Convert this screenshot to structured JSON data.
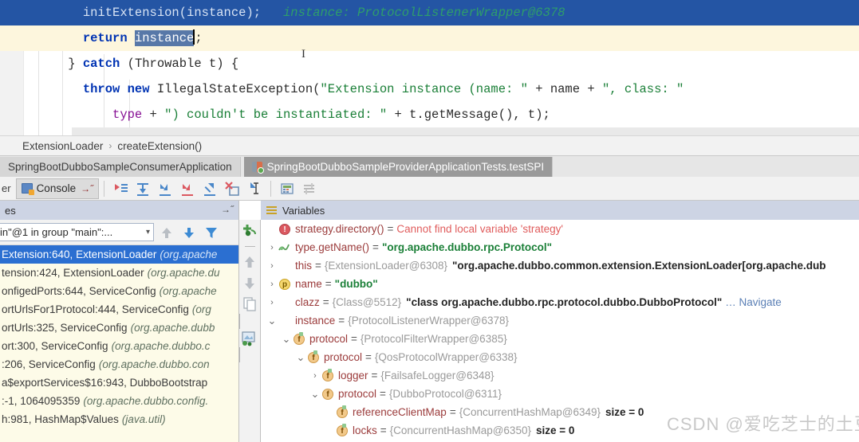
{
  "editor": {
    "lines": [
      {
        "indent": 6,
        "highlight": "selected",
        "tokens": [
          {
            "t": "initExtension",
            "c": "plain"
          },
          {
            "t": "(",
            "c": "plain"
          },
          {
            "t": "instance",
            "c": "plain"
          },
          {
            "t": ");",
            "c": "plain"
          }
        ],
        "hint": "instance: ProtocolListenerWrapper@6378"
      },
      {
        "indent": 6,
        "highlight": "current",
        "tokens": [
          {
            "t": "return ",
            "c": "kw"
          },
          {
            "t": "instance",
            "c": "selbox"
          },
          {
            "t": ";",
            "c": "plain"
          }
        ],
        "hint": ""
      },
      {
        "indent": 4,
        "highlight": "none",
        "tokens": [
          {
            "t": "} ",
            "c": "plain"
          },
          {
            "t": "catch ",
            "c": "kw"
          },
          {
            "t": "(Throwable t) {",
            "c": "plain"
          }
        ],
        "hint": ""
      },
      {
        "indent": 6,
        "highlight": "none",
        "tokens": [
          {
            "t": "throw new ",
            "c": "kw"
          },
          {
            "t": "IllegalStateException(",
            "c": "plain"
          },
          {
            "t": "\"Extension instance (name: \"",
            "c": "str"
          },
          {
            "t": " + ",
            "c": "plain"
          },
          {
            "t": "name",
            "c": "plain"
          },
          {
            "t": " + ",
            "c": "plain"
          },
          {
            "t": "\", class: \"",
            "c": "str"
          }
        ],
        "hint": ""
      },
      {
        "indent": 10,
        "highlight": "none",
        "tokens": [
          {
            "t": "type",
            "c": "fld"
          },
          {
            "t": " + ",
            "c": "plain"
          },
          {
            "t": "\") couldn't be instantiated: \"",
            "c": "str"
          },
          {
            "t": " + ",
            "c": "plain"
          },
          {
            "t": "t.getMessage(), t);",
            "c": "plain"
          }
        ],
        "hint": ""
      }
    ]
  },
  "breadcrumb": {
    "class_name": "ExtensionLoader",
    "separator": "›",
    "method_name": "createExtension()"
  },
  "run_tabs": [
    {
      "label": "SpringBootDubboSampleConsumerApplication",
      "active": false
    },
    {
      "label": "SpringBootDubboSampleProviderApplicationTests.testSPI",
      "active": true
    }
  ],
  "toolbar": {
    "left_label": "er",
    "console_label": "Console",
    "console_suffix": "→˝",
    "icons": [
      "show-execution-point-icon",
      "step-over-icon",
      "step-into-icon",
      "force-step-into-icon",
      "step-out-icon",
      "drop-frame-icon",
      "run-to-cursor-icon",
      "evaluate-expression-icon",
      "settings-lines-icon"
    ]
  },
  "frames_panel": {
    "title": "es",
    "collapse_glyph": "→˝",
    "thread_selector": "in\"@1 in group \"main\":...",
    "toolbar_icons": [
      "frames-up-icon",
      "frames-down-icon",
      "filter-icon"
    ],
    "frames": [
      {
        "text": "Extension:640, ExtensionLoader",
        "pkg": "(org.apache",
        "selected": true
      },
      {
        "text": "tension:424, ExtensionLoader",
        "pkg": "(org.apache.du",
        "selected": false
      },
      {
        "text": "onfigedPorts:644, ServiceConfig",
        "pkg": "(org.apache",
        "selected": false
      },
      {
        "text": "ortUrlsFor1Protocol:444, ServiceConfig",
        "pkg": "(org",
        "selected": false
      },
      {
        "text": "ortUrls:325, ServiceConfig",
        "pkg": "(org.apache.dubb",
        "selected": false
      },
      {
        "text": "ort:300, ServiceConfig",
        "pkg": "(org.apache.dubbo.c",
        "selected": false
      },
      {
        "text": ":206, ServiceConfig",
        "pkg": "(org.apache.dubbo.con",
        "selected": false
      },
      {
        "text": "a$exportServices$16:943, DubboBootstrap",
        "pkg": "",
        "selected": false
      },
      {
        "text": ":-1, 1064095359",
        "pkg": "(org.apache.dubbo.config.",
        "selected": false
      },
      {
        "text": "h:981, HashMap$Values",
        "pkg": "(java.util)",
        "selected": false
      }
    ]
  },
  "vstrip_icons": [
    "add-watch-icon",
    "remove-watch-icon",
    "move-up-icon",
    "move-down-icon",
    "copy-icon",
    "inspect-icon"
  ],
  "variables_panel": {
    "title": "Variables",
    "rows": [
      {
        "depth": 0,
        "twisty": "",
        "icon": "error-icon",
        "name": "strategy.directory()",
        "eq": "=",
        "value": "Cannot find local variable 'strategy'",
        "value_class": "verr",
        "extra": "",
        "extra_class": ""
      },
      {
        "depth": 0,
        "twisty": "›",
        "icon": "eval-icon",
        "name": "type.getName()",
        "eq": "=",
        "value": "\"org.apache.dubbo.rpc.Protocol\"",
        "value_class": "vval-str",
        "extra": "",
        "extra_class": ""
      },
      {
        "depth": 0,
        "twisty": "›",
        "icon": "list-icon",
        "name": "this",
        "eq": "=",
        "value": "{ExtensionLoader@6308}",
        "value_class": "vval-ref",
        "extra": "\"org.apache.dubbo.common.extension.ExtensionLoader[org.apache.dub",
        "extra_class": "vval-dark"
      },
      {
        "depth": 0,
        "twisty": "›",
        "icon": "param-icon",
        "name": "name",
        "eq": "=",
        "value": "\"dubbo\"",
        "value_class": "vval-str",
        "extra": "",
        "extra_class": ""
      },
      {
        "depth": 0,
        "twisty": "›",
        "icon": "list-icon",
        "name": "clazz",
        "eq": "=",
        "value": "{Class@5512}",
        "value_class": "vval-ref",
        "extra": "\"class org.apache.dubbo.rpc.protocol.dubbo.DubboProtocol\"",
        "extra_class": "vval-dark",
        "suffix": "… Navigate",
        "suffix_class": "vlink"
      },
      {
        "depth": 0,
        "twisty": "⌄",
        "icon": "list-icon",
        "name": "instance",
        "eq": "=",
        "value": "{ProtocolListenerWrapper@6378}",
        "value_class": "vval-ref",
        "extra": "",
        "extra_class": ""
      },
      {
        "depth": 1,
        "twisty": "⌄",
        "icon": "field-icon",
        "name": "protocol",
        "eq": "=",
        "value": "{ProtocolFilterWrapper@6385}",
        "value_class": "vval-ref",
        "extra": "",
        "extra_class": ""
      },
      {
        "depth": 2,
        "twisty": "⌄",
        "icon": "field-icon",
        "name": "protocol",
        "eq": "=",
        "value": "{QosProtocolWrapper@6338}",
        "value_class": "vval-ref",
        "extra": "",
        "extra_class": ""
      },
      {
        "depth": 3,
        "twisty": "›",
        "icon": "field-icon",
        "name": "logger",
        "eq": "=",
        "value": "{FailsafeLogger@6348}",
        "value_class": "vval-ref",
        "extra": "",
        "extra_class": ""
      },
      {
        "depth": 3,
        "twisty": "⌄",
        "icon": "field-plain-icon",
        "name": "protocol",
        "eq": "=",
        "value": "{DubboProtocol@6311}",
        "value_class": "vval-ref",
        "extra": "",
        "extra_class": ""
      },
      {
        "depth": 4,
        "twisty": "",
        "icon": "field-icon",
        "name": "referenceClientMap",
        "eq": "=",
        "value": "{ConcurrentHashMap@6349}",
        "value_class": "vval-ref",
        "extra": "size = 0",
        "extra_class": "vsize"
      },
      {
        "depth": 4,
        "twisty": "",
        "icon": "field-icon",
        "name": "locks",
        "eq": "=",
        "value": "{ConcurrentHashMap@6350}",
        "value_class": "vval-ref",
        "extra": "size = 0",
        "extra_class": "vsize"
      }
    ]
  },
  "watermark": {
    "text": "CSDN @爱吃芝士的土豆倪"
  },
  "colors": {
    "selection_blue": "#2455a4",
    "current_line": "#fdf6dd",
    "frames_bg": "#fdfbe8",
    "frame_selected": "#2b6fd1",
    "panel_header": "#cdd4e4",
    "error_red": "#e05c5c",
    "string_green": "#1a7f37",
    "keyword_blue": "#0033b3"
  }
}
